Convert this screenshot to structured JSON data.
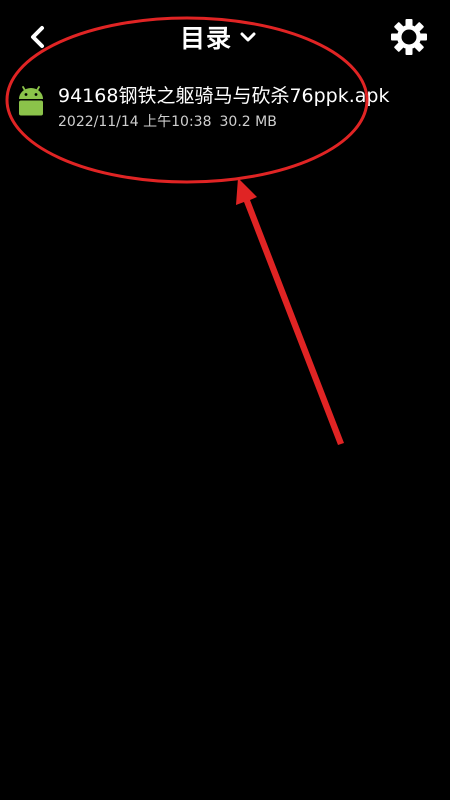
{
  "header": {
    "back_icon": "chevron-left-icon",
    "title": "目录",
    "title_dropdown_icon": "chevron-down-icon",
    "settings_icon": "gear-icon"
  },
  "file_list": [
    {
      "icon": "android-icon",
      "name": "94168钢铁之躯骑马与砍杀76ppk.apk",
      "date": "2022/11/14 上午10:38",
      "size": "30.2 MB"
    }
  ],
  "colors": {
    "background": "#000000",
    "text": "#ffffff",
    "meta_text": "#cfcfcf",
    "android_green": "#8bc34a",
    "annotation_red": "#e02424"
  }
}
